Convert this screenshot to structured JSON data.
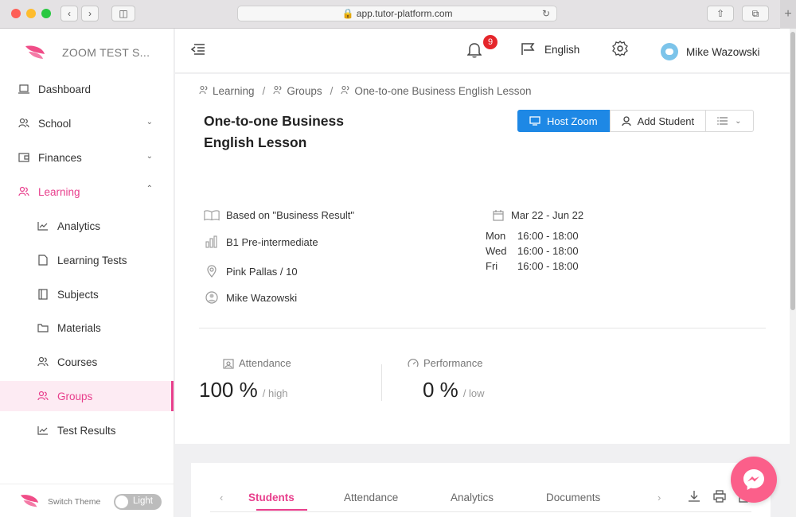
{
  "browser": {
    "url": "app.tutor-platform.com"
  },
  "sidebar": {
    "brand": "ZOOM TEST S...",
    "items": [
      {
        "label": "Dashboard",
        "icon": "laptop-icon"
      },
      {
        "label": "School",
        "icon": "people-icon",
        "chevron": "down"
      },
      {
        "label": "Finances",
        "icon": "wallet-icon",
        "chevron": "down"
      },
      {
        "label": "Learning",
        "icon": "people-icon",
        "chevron": "up",
        "expanded": true
      },
      {
        "label": "Analytics",
        "icon": "line-chart-icon"
      },
      {
        "label": "Learning Tests",
        "icon": "file-icon"
      },
      {
        "label": "Subjects",
        "icon": "book-icon"
      },
      {
        "label": "Materials",
        "icon": "folder-icon"
      },
      {
        "label": "Courses",
        "icon": "people-icon"
      },
      {
        "label": "Groups",
        "icon": "people-icon",
        "active": true
      },
      {
        "label": "Test Results",
        "icon": "line-chart-icon"
      }
    ],
    "theme": {
      "label": "Switch Theme",
      "toggle_label": "Light"
    }
  },
  "header": {
    "notifications_count": "9",
    "language": "English",
    "user_name": "Mike Wazowski"
  },
  "breadcrumb": [
    "Learning",
    "Groups",
    "One-to-one Business English Lesson"
  ],
  "lesson": {
    "title": "One-to-one Business English Lesson",
    "buttons": {
      "host_zoom": "Host Zoom",
      "add_student": "Add Student"
    },
    "course": "Based on \"Business Result\"",
    "level": "B1 Pre-intermediate",
    "room": "Pink Pallas / 10",
    "teacher": "Mike Wazowski",
    "dates": "Mar 22 - Jun 22",
    "schedule": [
      {
        "day": "Mon",
        "time": "16:00 - 18:00"
      },
      {
        "day": "Wed",
        "time": "16:00 - 18:00"
      },
      {
        "day": "Fri",
        "time": "16:00 - 18:00"
      }
    ]
  },
  "stats": {
    "attendance": {
      "label": "Attendance",
      "value": "100 %",
      "note": "/ high"
    },
    "performance": {
      "label": "Performance",
      "value": "0 %",
      "note": "/ low"
    }
  },
  "tabs": [
    "Students",
    "Attendance",
    "Analytics",
    "Documents"
  ],
  "colors": {
    "accent": "#e83e8c",
    "primary": "#1e88e5",
    "badge": "#e5262b",
    "fab": "#fb5f8a"
  }
}
